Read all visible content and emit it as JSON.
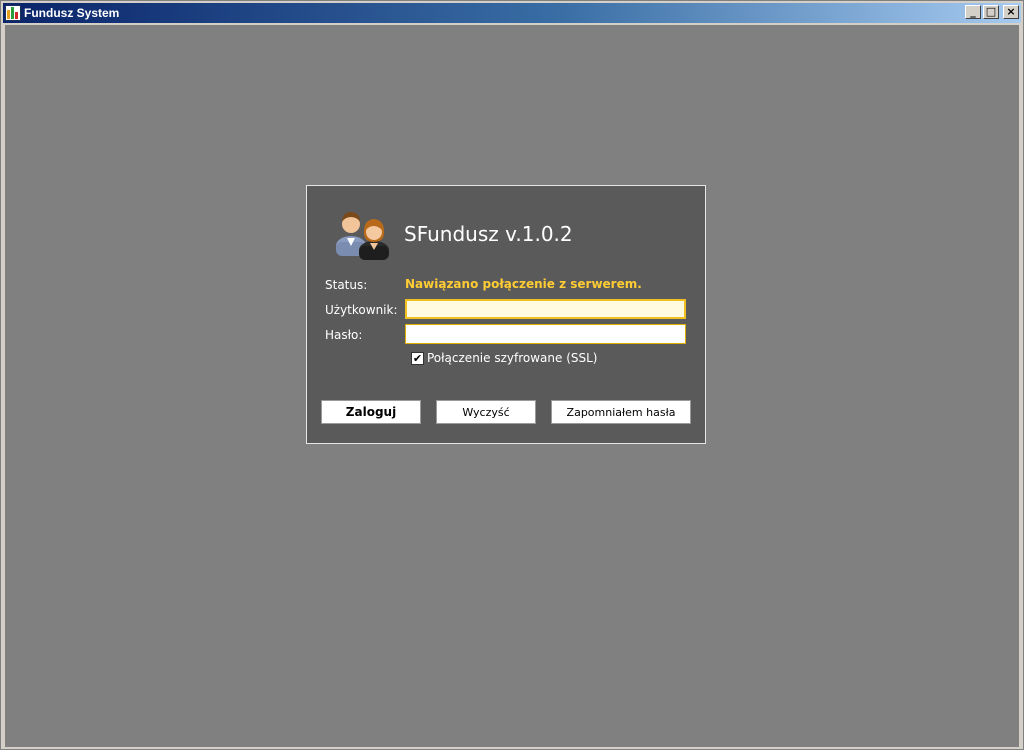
{
  "window": {
    "title": "Fundusz System",
    "minimize_glyph": "_",
    "maximize_glyph": "□",
    "close_glyph": "×",
    "icon": "app-bar-chart-icon"
  },
  "login": {
    "app_title": "SFundusz v.1.0.2",
    "avatar_icon": "users-icon",
    "status_label": "Status:",
    "status_value": "Nawiązano połączenie z serwerem.",
    "status_color": "#ffcc33",
    "user_label": "Użytkownik:",
    "user_value": "",
    "password_label": "Hasło:",
    "password_value": "",
    "ssl_label": "Połączenie szyfrowane (SSL)",
    "ssl_checked": true,
    "login_button": "Zaloguj",
    "clear_button": "Wyczyść",
    "forgot_button": "Zapomniałem hasła"
  },
  "colors": {
    "workspace": "#808080",
    "dialog": "#5a5a5a",
    "field_focus_border": "#f0c020"
  }
}
